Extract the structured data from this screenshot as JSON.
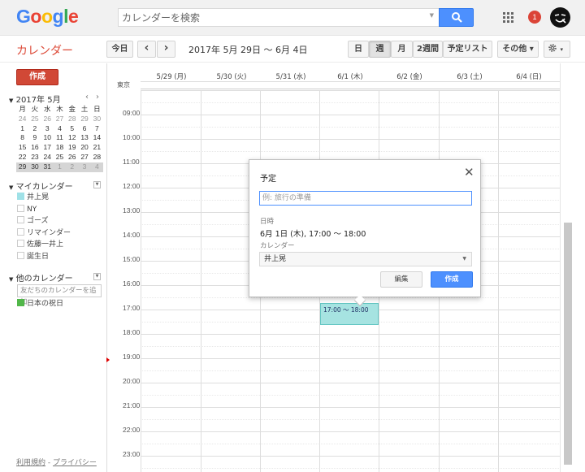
{
  "header": {
    "logo": [
      "G",
      "o",
      "o",
      "g",
      "l",
      "e"
    ],
    "logo_colors": [
      "#4285f4",
      "#ea4335",
      "#fbbc05",
      "#4285f4",
      "#34a853",
      "#ea4335"
    ],
    "search_placeholder": "カレンダーを検索",
    "notification_count": "1"
  },
  "toolbar": {
    "app_title": "カレンダー",
    "today": "今日",
    "prev": "‹",
    "next": "›",
    "date_range": "2017年 5月 29日 ～ 6月 4日",
    "view_day": "日",
    "view_week": "週",
    "view_month": "月",
    "view_2weeks": "2週間",
    "view_agenda": "予定リスト",
    "more": "その他 ▾",
    "settings": "▾",
    "active_view": "週"
  },
  "sidebar": {
    "create": "作成",
    "minical": {
      "title": "2017年 5月",
      "prev": "‹",
      "next": "›",
      "weekdays": [
        "月",
        "火",
        "水",
        "木",
        "金",
        "土",
        "日"
      ],
      "weeks": [
        [
          "24",
          "25",
          "26",
          "27",
          "28",
          "29",
          "30"
        ],
        [
          "1",
          "2",
          "3",
          "4",
          "5",
          "6",
          "7"
        ],
        [
          "8",
          "9",
          "10",
          "11",
          "12",
          "13",
          "14"
        ],
        [
          "15",
          "16",
          "17",
          "18",
          "19",
          "20",
          "21"
        ],
        [
          "22",
          "23",
          "24",
          "25",
          "26",
          "27",
          "28"
        ],
        [
          "29",
          "30",
          "31",
          "1",
          "2",
          "3",
          "4"
        ]
      ]
    },
    "my_calendars_title": "マイカレンダー",
    "my_calendars": [
      {
        "label": "井上晃",
        "color": "#9fe1e7"
      },
      {
        "label": "NY",
        "color": ""
      },
      {
        "label": "ゴーズ",
        "color": ""
      },
      {
        "label": "リマインダー",
        "color": ""
      },
      {
        "label": "佐藤一井上",
        "color": ""
      },
      {
        "label": "誕生日",
        "color": ""
      }
    ],
    "other_calendars_title": "他のカレンダー",
    "friend_placeholder": "友だちのカレンダーを追加",
    "other_calendars": [
      {
        "label": "日本の祝日",
        "color": "#51b749"
      }
    ],
    "footer_terms": "利用規約",
    "footer_sep": " - ",
    "footer_privacy": "プライバシー"
  },
  "grid": {
    "timezone": "東京",
    "days": [
      "5/29 (月)",
      "5/30 (火)",
      "5/31 (水)",
      "6/1 (木)",
      "6/2 (金)",
      "6/3 (土)",
      "6/4 (日)"
    ],
    "hours": [
      "09:00",
      "10:00",
      "11:00",
      "12:00",
      "13:00",
      "14:00",
      "15:00",
      "16:00",
      "17:00",
      "18:00",
      "19:00",
      "20:00",
      "21:00",
      "22:00",
      "23:00"
    ]
  },
  "event": {
    "time": "17:00 ～ 18:00",
    "color": "#a6e3e1"
  },
  "popup": {
    "title": "予定",
    "close": "✕",
    "input_placeholder": "例: 旅行の準備",
    "when_label": "日時",
    "when_value": "6月 1日 (木), 17:00 ～ 18:00",
    "calendar_label": "カレンダー",
    "calendar_value": "井上晃",
    "edit": "編集",
    "create": "作成"
  }
}
